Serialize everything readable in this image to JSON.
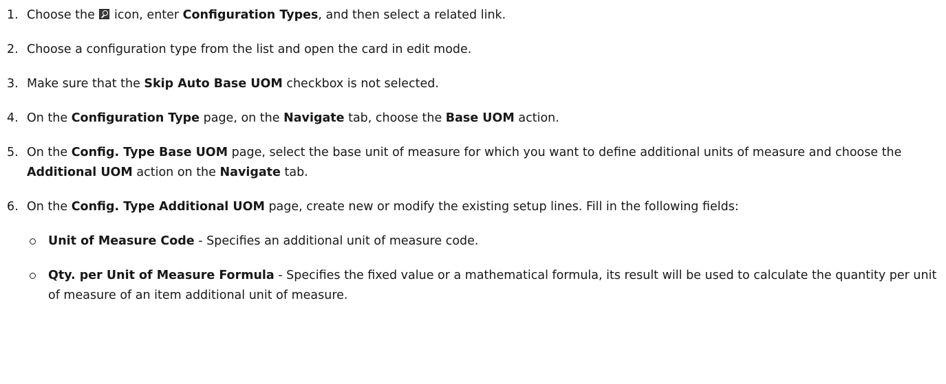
{
  "steps": [
    {
      "num": "1.",
      "t1": "Choose the ",
      "t2": " icon, enter ",
      "b1": "Configuration Types",
      "t3": ", and then select a related link."
    },
    {
      "num": "2.",
      "t1": "Choose a configuration type from the list and open the card in edit mode."
    },
    {
      "num": "3.",
      "t1": "Make sure that the ",
      "b1": "Skip Auto Base UOM",
      "t2": " checkbox is not selected."
    },
    {
      "num": "4.",
      "t1": "On the ",
      "b1": "Configuration Type",
      "t2": " page, on the ",
      "b2": "Navigate",
      "t3": " tab, choose the ",
      "b3": "Base UOM",
      "t4": " action."
    },
    {
      "num": "5.",
      "t1": "On the ",
      "b1": "Config. Type Base UOM",
      "t2": " page, select the base unit of measure for which you want to define additional units of measure and choose the ",
      "b2": "Additional UOM",
      "t3": " action on the ",
      "b3": "Navigate",
      "t4": " tab."
    },
    {
      "num": "6.",
      "t1": "On the ",
      "b1": "Config. Type Additional UOM",
      "t2": " page, create new or modify the existing setup lines. Fill in the following fields:",
      "fields": [
        {
          "name": "Unit of Measure Code",
          "desc": " - Specifies an additional unit of measure code."
        },
        {
          "name": "Qty. per Unit of Measure Formula",
          "desc": " - Specifies the fixed value or a mathematical formula, its result will be used to calculate the quantity per unit of measure of an item additional unit of measure."
        }
      ]
    }
  ],
  "icons": {
    "search": "search-icon"
  }
}
